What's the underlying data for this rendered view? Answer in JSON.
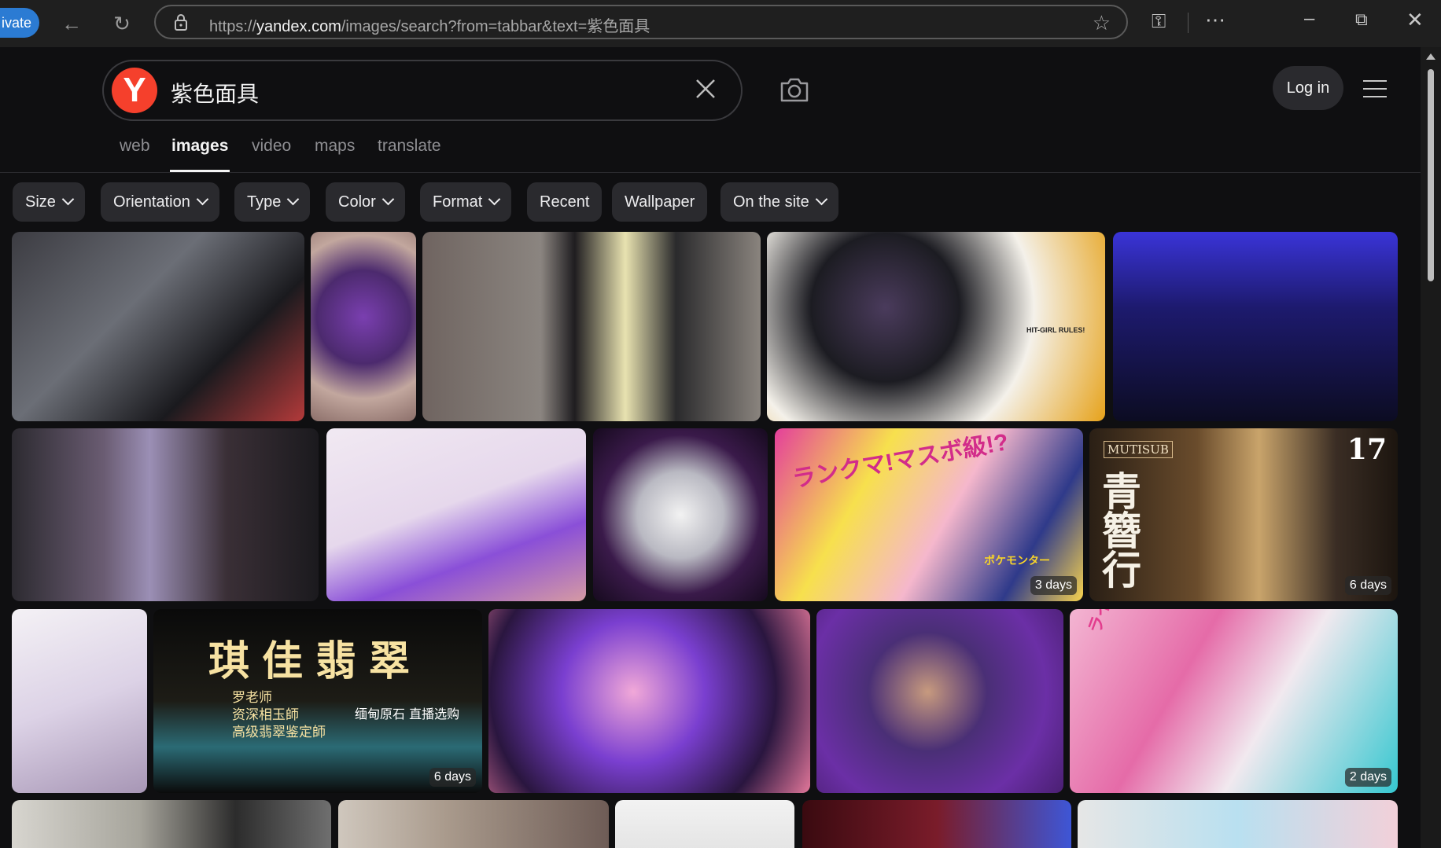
{
  "browser": {
    "private_label": "ivate",
    "url_prefix": "https://",
    "url_domain": "yandex.com",
    "url_rest": "/images/search?from=tabbar&text=紫色面具"
  },
  "search": {
    "logo_letter": "Y",
    "query": "紫色面具",
    "login_label": "Log in"
  },
  "tabs": [
    "web",
    "images",
    "video",
    "maps",
    "translate"
  ],
  "filters": [
    {
      "label": "Size",
      "dropdown": true
    },
    {
      "label": "Orientation",
      "dropdown": true
    },
    {
      "label": "Type",
      "dropdown": true
    },
    {
      "label": "Color",
      "dropdown": true
    },
    {
      "label": "Format",
      "dropdown": true
    },
    {
      "label": "Recent",
      "dropdown": false
    },
    {
      "label": "Wallpaper",
      "dropdown": false
    },
    {
      "label": "On the site",
      "dropdown": true
    }
  ],
  "results": {
    "badges": {
      "t9": "3 days",
      "t10": "6 days",
      "t12": "6 days",
      "t15": "2 days"
    },
    "overlay_texts": {
      "hitgirl": "HIT-GIRL RULES!",
      "mutisub": "MUTISUB",
      "episode": "17",
      "drama_title": "青簪行",
      "jade_title": "琪佳翡翠",
      "jade_teacher": "罗老师",
      "jade_line1": "资深相玉師",
      "jade_line2": "高级翡翠鉴定師",
      "jade_line3": "缅甸原石 直播选购",
      "ranked": "ランクマ!マスボ級!?",
      "pokemon": "ポケモンター",
      "live": "ライブ!"
    }
  }
}
